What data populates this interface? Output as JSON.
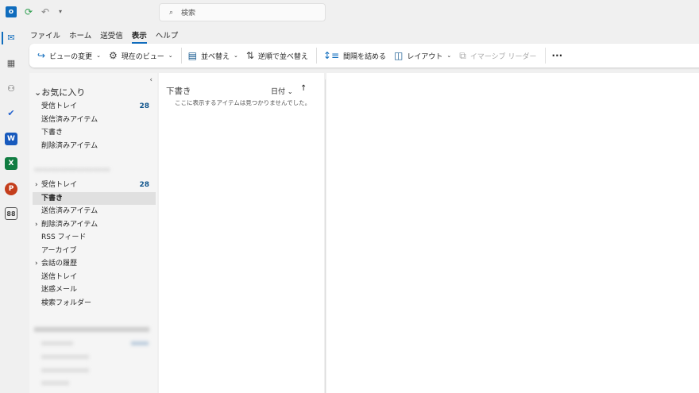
{
  "titlebar": {
    "search_placeholder": "検索",
    "icons": [
      "outlook-icon",
      "sync-icon",
      "undo-icon",
      "customize-quick-access-icon"
    ]
  },
  "rail": {
    "icons": [
      "mail-icon",
      "calendar-icon",
      "people-icon",
      "todo-icon",
      "word-icon",
      "excel-icon",
      "powerpoint-icon",
      "apps-icon"
    ]
  },
  "menu_tabs": [
    {
      "label": "ファイル"
    },
    {
      "label": "ホーム"
    },
    {
      "label": "送受信"
    },
    {
      "label": "表示",
      "active": true
    },
    {
      "label": "ヘルプ"
    }
  ],
  "ribbon": {
    "change_view": "ビューの変更",
    "current_view": "現在のビュー",
    "sort": "並べ替え",
    "reverse_sort": "逆順で並べ替え",
    "compact": "間隔を詰める",
    "layout": "レイアウト",
    "immersive_reader": "イマーシブ リーダー",
    "more": "···"
  },
  "favorites": {
    "title": "お気に入り",
    "items": [
      {
        "label": "受信トレイ",
        "count": "28"
      },
      {
        "label": "送信済みアイテム"
      },
      {
        "label": "下書き"
      },
      {
        "label": "削除済みアイテム"
      }
    ]
  },
  "account1": {
    "name": "••••••••••••••••••",
    "items": [
      {
        "label": "受信トレイ",
        "count": "28",
        "expand": true
      },
      {
        "label": "下書き",
        "selected": true
      },
      {
        "label": "送信済みアイテム"
      },
      {
        "label": "削除済みアイテム",
        "expand": true
      },
      {
        "label": "RSS フィード"
      },
      {
        "label": "アーカイブ"
      },
      {
        "label": "会話の履歴",
        "expand": true
      },
      {
        "label": "送信トレイ"
      },
      {
        "label": "迷惑メール"
      },
      {
        "label": "検索フォルダー"
      }
    ]
  },
  "list": {
    "folder_title": "下書き",
    "sort_label": "日付",
    "empty_message": "ここに表示するアイテムは見つかりませんでした。"
  },
  "colors": {
    "accent": "#0f6cbd",
    "count": "#0f548c"
  }
}
